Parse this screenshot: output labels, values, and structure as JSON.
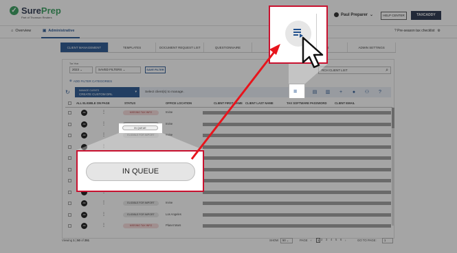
{
  "brand": {
    "name_a": "Sure",
    "name_b": "Prep",
    "tagline": "Part of Thomson Reuters",
    "mark_color": "#2e9a57",
    "navy": "#1e2a44"
  },
  "header": {
    "user_name": "Paul Preparer",
    "help_label": "HELP CENTER",
    "taxcaddy_label": "TAXCADDY"
  },
  "nav": {
    "overview": "Overview",
    "administrative": "Administrative",
    "checklist": "Pre-season tax checklist"
  },
  "tabs": [
    "CLIENT MANAGEMENT",
    "TEMPLATES",
    "DOCUMENT REQUEST LIST",
    "QUESTIONNAIRE",
    "",
    "",
    "ADMIN SETTINGS"
  ],
  "tab_partial": "ETAILS",
  "filters": {
    "tax_year_label": "Tax Year",
    "tax_year_value": "2023",
    "saved_filters": "SAVED FILTERS",
    "save_filter": "SAVE FILTER",
    "search_placeholder": "RCH CLIENT LIST",
    "add_filter": "ADD FILTER CATEGORIES"
  },
  "toolbar": {
    "manage_line1": "MANAGE CLIENTS",
    "manage_line2": "CREATE CUSTOM DRL",
    "select_msg": "Select client(s) to manage."
  },
  "table": {
    "headers": {
      "eligible": "ALL ELIGIBLE ON PAGE",
      "status": "STATUS",
      "office": "OFFICE LOCATION",
      "first": "CLIENT FIRST NAME",
      "last": "CLIENT LAST NAME",
      "tax_pw": "TAX SOFTWARE PASSWORD",
      "email": "CLIENT EMAIL"
    },
    "rows": [
      {
        "avatar": "AB",
        "status": "MISSING TAX INFO",
        "kind": "missing",
        "office": "Irvine"
      },
      {
        "avatar": "AB",
        "status": "IN QUEUE",
        "kind": "queue",
        "office": "Irvine"
      },
      {
        "avatar": "AB",
        "status": "ELIGIBLE FOR IMPORT",
        "kind": "elig",
        "office": "Irvine"
      },
      {
        "avatar": "",
        "status": "",
        "kind": "",
        "office": ""
      },
      {
        "avatar": "",
        "status": "",
        "kind": "",
        "office": ""
      },
      {
        "avatar": "",
        "status": "",
        "kind": "",
        "office": ""
      },
      {
        "avatar": "",
        "status": "",
        "kind": "",
        "office": ""
      },
      {
        "avatar": "",
        "status": "",
        "kind": "",
        "office": ""
      },
      {
        "avatar": "AB",
        "status": "ELIGIBLE FOR IMPORT",
        "kind": "elig",
        "office": "Irvine"
      },
      {
        "avatar": "AB",
        "status": "ELIGIBLE FOR IMPORT",
        "kind": "elig",
        "office": "Los Angeles"
      },
      {
        "avatar": "AB",
        "status": "MISSING TAX INFO",
        "kind": "missing",
        "office": "Planet Mars"
      }
    ]
  },
  "footer": {
    "viewing": "Viewing",
    "range_a": "1",
    "range_b": "50",
    "of": "of",
    "total": "251",
    "show": "SHOW",
    "show_value": "50",
    "page": "PAGE",
    "pages": [
      "1",
      "2",
      "3",
      "4",
      "5",
      "6"
    ],
    "goto": "GO TO PAGE:",
    "goto_value": "1"
  },
  "callout": {
    "label": "IN QUEUE"
  },
  "highlight": {
    "label": "IN QUEUE"
  },
  "accent_red": "#c8102e"
}
